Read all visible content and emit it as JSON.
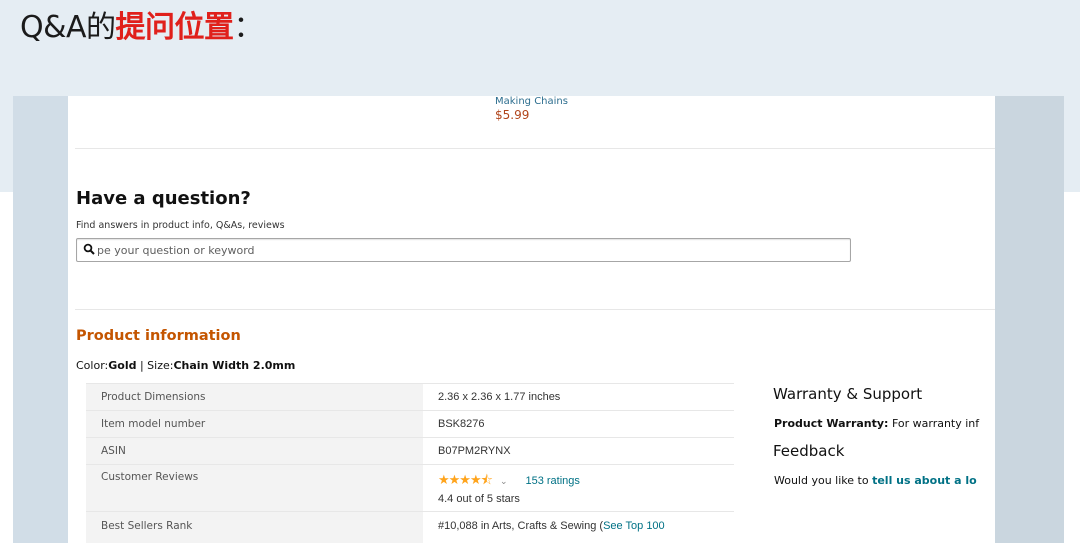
{
  "slide": {
    "title_prefix": "Q&A的",
    "title_highlight": "提问位置",
    "title_suffix": "："
  },
  "product_card": {
    "name": "Making Chains",
    "price": "$5.99"
  },
  "question": {
    "title": "Have a question?",
    "subtitle": "Find answers in product info, Q&As, reviews",
    "placeholder": "pe your question or keyword",
    "icon": "search-icon"
  },
  "product_info": {
    "title": "Product information",
    "color_label": "Color:",
    "color_value": "Gold",
    "separator": " | ",
    "size_label": "Size:",
    "size_value": "Chain Width 2.0mm",
    "rows": [
      {
        "label": "Product Dimensions",
        "value": "2.36 x 2.36 x 1.77 inches"
      },
      {
        "label": "Item model number",
        "value": "BSK8276"
      },
      {
        "label": "ASIN",
        "value": "B07PM2RYNX"
      }
    ],
    "reviews": {
      "label": "Customer Reviews",
      "stars": "★★★★",
      "half_star": "⯪",
      "rating_value": 4.4,
      "ratings_count": "153 ratings",
      "rating_text": "4.4 out of 5 stars"
    },
    "rank": {
      "label": "Best Sellers Rank",
      "value": "#10,088 in Arts, Crafts & Sewing (",
      "link": "See Top 100"
    }
  },
  "sidebar": {
    "warranty_title": "Warranty & Support",
    "warranty_label": "Product Warranty:",
    "warranty_text": " For warranty inf",
    "feedback_title": "Feedback",
    "feedback_text": "Would you like to ",
    "feedback_link": "tell us about a lo"
  },
  "colors": {
    "accent_orange": "#c45500",
    "price": "#b1451b",
    "link": "#007185",
    "star": "#ffa41c",
    "title_highlight": "#e0201b"
  }
}
